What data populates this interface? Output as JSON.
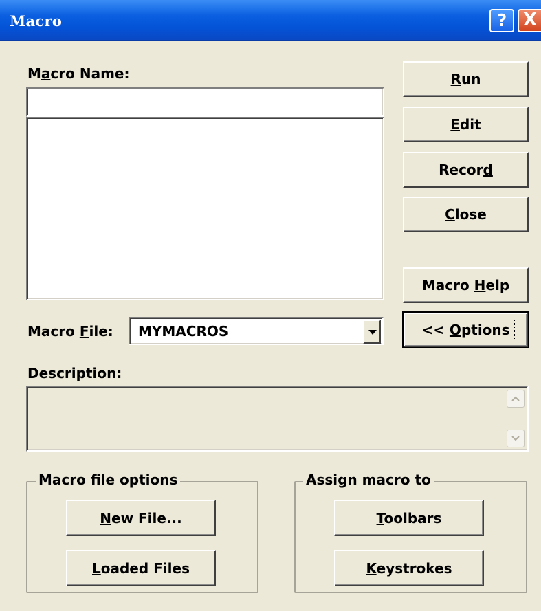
{
  "window": {
    "title": "Macro",
    "help_button": "?",
    "close_button": "X"
  },
  "macro_name": {
    "label_pre": "M",
    "label_access": "a",
    "label_post": "cro Name:",
    "value": ""
  },
  "macro_list": {
    "items": []
  },
  "macro_file": {
    "label_pre": "Macro ",
    "label_access": "F",
    "label_post": "ile:",
    "selected": "MYMACROS"
  },
  "description": {
    "label": "Description:",
    "value": ""
  },
  "buttons": {
    "run": {
      "access": "R",
      "rest": "un"
    },
    "edit": {
      "access": "E",
      "rest": "dit"
    },
    "record": {
      "pre": "Recor",
      "access": "d",
      "rest": ""
    },
    "close": {
      "access": "C",
      "rest": "lose"
    },
    "macro_help": {
      "pre": "Macro ",
      "access": "H",
      "rest": "elp"
    },
    "options": {
      "pre": "<< ",
      "access": "O",
      "rest": "ptions"
    }
  },
  "macro_file_options": {
    "legend": "Macro file options",
    "new_file": {
      "access": "N",
      "rest": "ew File..."
    },
    "loaded_files": {
      "access": "L",
      "rest": "oaded Files"
    }
  },
  "assign_macro_to": {
    "legend": "Assign macro to",
    "toolbars": {
      "access": "T",
      "rest": "oolbars"
    },
    "keystrokes": {
      "access": "K",
      "rest": "eystrokes"
    }
  },
  "colors": {
    "dialog_bg": "#ece9d8",
    "titlebar": "#0a5fe0",
    "close_button": "#d2451f"
  }
}
